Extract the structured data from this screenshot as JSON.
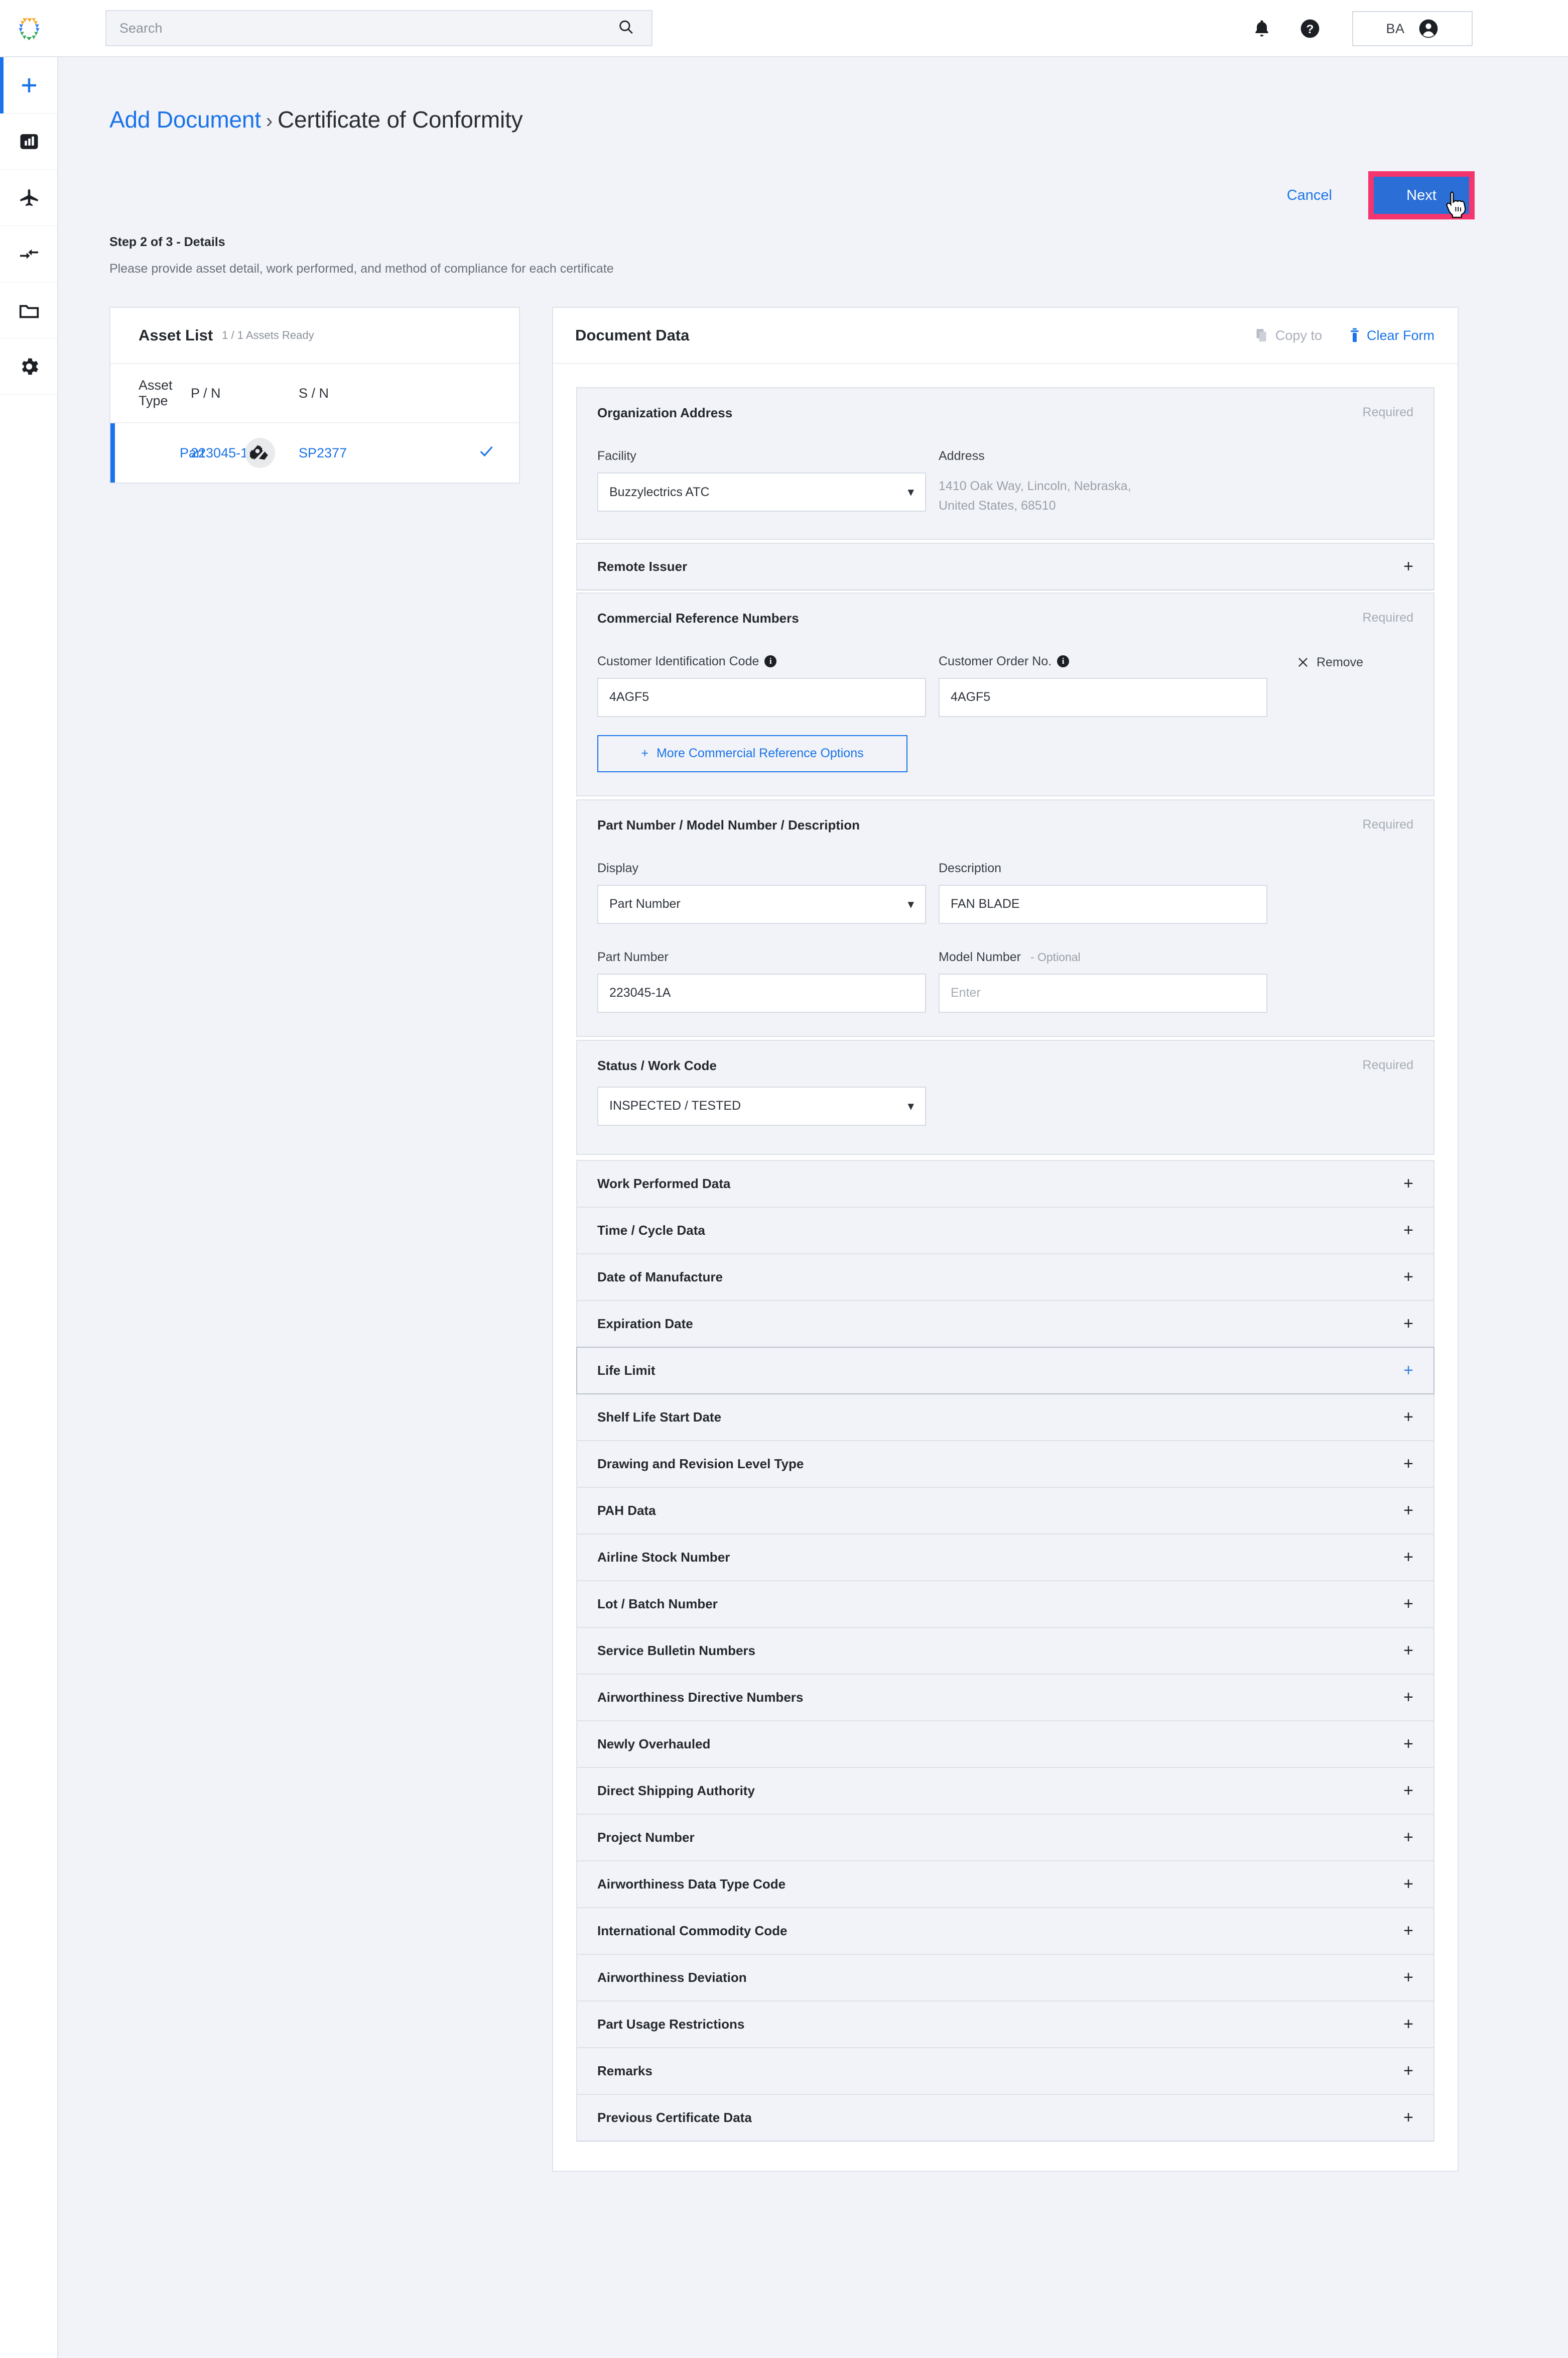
{
  "topbar": {
    "logo_icon": "hexagon-logo",
    "search": {
      "placeholder": "Search",
      "value": "",
      "icon": "search-icon"
    },
    "notifications_icon": "bell-icon",
    "help_icon": "question-circle-icon",
    "user_initials": "BA",
    "account_icon": "account-circle-icon"
  },
  "leftnav": {
    "items": [
      {
        "icon": "plus-icon",
        "name": "add",
        "active": true
      },
      {
        "icon": "bar-chart-icon",
        "name": "analytics",
        "active": false
      },
      {
        "icon": "airplane-icon",
        "name": "fleet",
        "active": false
      },
      {
        "icon": "transfer-arrows-icon",
        "name": "transfers",
        "active": false
      },
      {
        "icon": "folder-icon",
        "name": "documents",
        "active": false
      },
      {
        "icon": "gear-icon",
        "name": "settings",
        "active": false
      }
    ]
  },
  "header": {
    "breadcrumb_link": "Add Document",
    "breadcrumb_separator": "›",
    "breadcrumb_current": "Certificate of Conformity",
    "step_title": "Step 2 of 3 - Details",
    "step_subtitle": "Please provide asset detail, work performed, and method of compliance for each certificate",
    "cancel_label": "Cancel",
    "next_label": "Next",
    "next_highlight_color": "#f4356e",
    "next_button_color": "#2b6fd6",
    "accent_color": "#1a73e8"
  },
  "asset_list": {
    "title": "Asset List",
    "counter": "1 / 1 Assets Ready",
    "columns": [
      "Asset Type",
      "P / N",
      "S / N"
    ],
    "rows": [
      {
        "icon": "part-gear-icon",
        "asset_type": "Part",
        "pn": "223045-1A",
        "sn": "SP2377",
        "ready_icon": "check-icon",
        "selected": true
      }
    ]
  },
  "document_data": {
    "title": "Document Data",
    "copy_to_label": "Copy to",
    "copy_to_icon": "copy-icon",
    "clear_form_label": "Clear Form",
    "clear_form_icon": "trash-icon",
    "required_label": "Required",
    "sections": {
      "organization_address": {
        "title": "Organization Address",
        "required": "Required",
        "facility_label": "Facility",
        "facility_value": "Buzzylectrics ATC",
        "address_label": "Address",
        "address_line1": "1410  Oak Way, Lincoln, Nebraska,",
        "address_line2": "United States, 68510"
      },
      "remote_issuer": {
        "title": "Remote Issuer",
        "expand_icon": "plus-icon"
      },
      "commercial_reference_numbers": {
        "title": "Commercial Reference Numbers",
        "required": "Required",
        "cic_label": "Customer Identification Code",
        "cic_info_icon": "info-icon",
        "cic_value": "4AGF5",
        "con_label": "Customer Order No.",
        "con_info_icon": "info-icon",
        "con_value": "4AGF5",
        "remove_label": "Remove",
        "remove_icon": "close-icon",
        "more_label": "More Commercial Reference Options",
        "more_icon": "plus-icon"
      },
      "part_number": {
        "title": "Part Number / Model Number / Description",
        "required": "Required",
        "display_label": "Display",
        "display_value": "Part Number",
        "description_label": "Description",
        "description_value": "FAN BLADE",
        "part_number_label": "Part Number",
        "part_number_value": "223045-1A",
        "model_number_label": "Model Number",
        "model_number_optional": "- Optional",
        "model_number_placeholder": "Enter",
        "model_number_value": ""
      },
      "status_work_code": {
        "title": "Status / Work Code",
        "required": "Required",
        "value": "INSPECTED / TESTED"
      }
    },
    "collapsed_sections": [
      {
        "label": "Work Performed Data",
        "expand_icon": "plus-icon",
        "hover": false
      },
      {
        "label": "Time / Cycle Data",
        "expand_icon": "plus-icon",
        "hover": false
      },
      {
        "label": "Date of Manufacture",
        "expand_icon": "plus-icon",
        "hover": false
      },
      {
        "label": "Expiration Date",
        "expand_icon": "plus-icon",
        "hover": false
      },
      {
        "label": "Life Limit",
        "expand_icon": "plus-icon",
        "hover": true
      },
      {
        "label": "Shelf Life Start Date",
        "expand_icon": "plus-icon",
        "hover": false
      },
      {
        "label": "Drawing and Revision Level Type",
        "expand_icon": "plus-icon",
        "hover": false
      },
      {
        "label": "PAH Data",
        "expand_icon": "plus-icon",
        "hover": false
      },
      {
        "label": "Airline Stock Number",
        "expand_icon": "plus-icon",
        "hover": false
      },
      {
        "label": "Lot / Batch Number",
        "expand_icon": "plus-icon",
        "hover": false
      },
      {
        "label": "Service Bulletin Numbers",
        "expand_icon": "plus-icon",
        "hover": false
      },
      {
        "label": "Airworthiness Directive Numbers",
        "expand_icon": "plus-icon",
        "hover": false
      },
      {
        "label": "Newly Overhauled",
        "expand_icon": "plus-icon",
        "hover": false
      },
      {
        "label": "Direct Shipping Authority",
        "expand_icon": "plus-icon",
        "hover": false
      },
      {
        "label": "Project Number",
        "expand_icon": "plus-icon",
        "hover": false
      },
      {
        "label": "Airworthiness Data Type Code",
        "expand_icon": "plus-icon",
        "hover": false
      },
      {
        "label": "International Commodity Code",
        "expand_icon": "plus-icon",
        "hover": false
      },
      {
        "label": "Airworthiness Deviation",
        "expand_icon": "plus-icon",
        "hover": false
      },
      {
        "label": "Part Usage Restrictions",
        "expand_icon": "plus-icon",
        "hover": false
      },
      {
        "label": "Remarks",
        "expand_icon": "plus-icon",
        "hover": false
      },
      {
        "label": "Previous Certificate Data",
        "expand_icon": "plus-icon",
        "hover": false
      }
    ]
  }
}
